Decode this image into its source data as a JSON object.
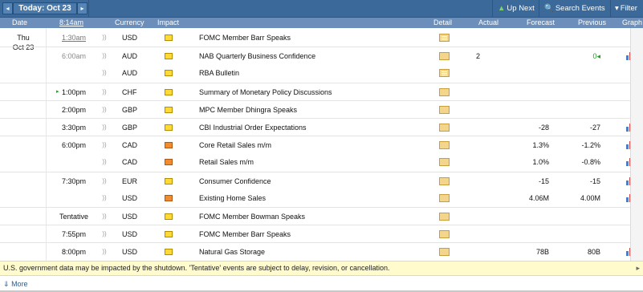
{
  "toolbar": {
    "prev_icon": "◂",
    "next_icon": "▸",
    "today_label": "Today: Oct 23",
    "up_next_icon": "up-arrow",
    "up_next_label": "Up Next",
    "search_label": "Search Events",
    "filter_label": "Filter"
  },
  "columns": {
    "date": "Date",
    "time": "8:14am",
    "currency": "Currency",
    "impact": "Impact",
    "detail": "Detail",
    "actual": "Actual",
    "forecast": "Forecast",
    "previous": "Previous",
    "graph": "Graph"
  },
  "day": {
    "weekday": "Thu",
    "date": "Oct 23"
  },
  "events": [
    {
      "time": "1:30am",
      "currency": "USD",
      "impact": "yellow",
      "event": "FOMC Member Barr Speaks",
      "detail_lines": true,
      "actual": "",
      "forecast": "",
      "previous": "",
      "graph": false
    },
    {
      "time": "6:00am",
      "currency": "AUD",
      "impact": "yellow",
      "event": "NAB Quarterly Business Confidence",
      "detail_lines": false,
      "actual": "2",
      "forecast": "",
      "previous": "0◂",
      "previous_color": "#2a9a2a",
      "graph": true
    },
    {
      "time": "",
      "currency": "AUD",
      "impact": "yellow",
      "event": "RBA Bulletin",
      "detail_lines": true,
      "actual": "",
      "forecast": "",
      "previous": "",
      "graph": false
    },
    {
      "time": "1:00pm",
      "current": true,
      "currency": "CHF",
      "impact": "yellow",
      "event": "Summary of Monetary Policy Discussions",
      "detail_lines": false,
      "actual": "",
      "forecast": "",
      "previous": "",
      "graph": false
    },
    {
      "time": "2:00pm",
      "currency": "GBP",
      "impact": "yellow",
      "event": "MPC Member Dhingra Speaks",
      "detail_lines": false,
      "actual": "",
      "forecast": "",
      "previous": "",
      "graph": false
    },
    {
      "time": "3:30pm",
      "currency": "GBP",
      "impact": "yellow",
      "event": "CBI Industrial Order Expectations",
      "detail_lines": false,
      "actual": "",
      "forecast": "-28",
      "previous": "-27",
      "graph": true
    },
    {
      "time": "6:00pm",
      "currency": "CAD",
      "impact": "orange",
      "event": "Core Retail Sales m/m",
      "detail_lines": false,
      "actual": "",
      "forecast": "1.3%",
      "previous": "-1.2%",
      "graph": true
    },
    {
      "time": "",
      "currency": "CAD",
      "impact": "orange",
      "event": "Retail Sales m/m",
      "detail_lines": false,
      "actual": "",
      "forecast": "1.0%",
      "previous": "-0.8%",
      "graph": true
    },
    {
      "time": "7:30pm",
      "currency": "EUR",
      "impact": "yellow",
      "event": "Consumer Confidence",
      "detail_lines": false,
      "actual": "",
      "forecast": "-15",
      "previous": "-15",
      "graph": true
    },
    {
      "time": "",
      "currency": "USD",
      "impact": "orange",
      "event": "Existing Home Sales",
      "detail_lines": false,
      "actual": "",
      "forecast": "4.06M",
      "previous": "4.00M",
      "graph": true
    },
    {
      "time": "Tentative",
      "currency": "USD",
      "impact": "yellow",
      "event": "FOMC Member Bowman Speaks",
      "detail_lines": false,
      "actual": "",
      "forecast": "",
      "previous": "",
      "graph": false
    },
    {
      "time": "7:55pm",
      "currency": "USD",
      "impact": "yellow",
      "event": "FOMC Member Barr Speaks",
      "detail_lines": false,
      "actual": "",
      "forecast": "",
      "previous": "",
      "graph": false
    },
    {
      "time": "8:00pm",
      "currency": "USD",
      "impact": "yellow",
      "event": "Natural Gas Storage",
      "detail_lines": false,
      "actual": "",
      "forecast": "78B",
      "previous": "80B",
      "graph": true
    }
  ],
  "notice": "U.S. government data may be impacted by the shutdown. 'Tentative' events are subject to delay, revision, or cancellation.",
  "more_label": "More"
}
